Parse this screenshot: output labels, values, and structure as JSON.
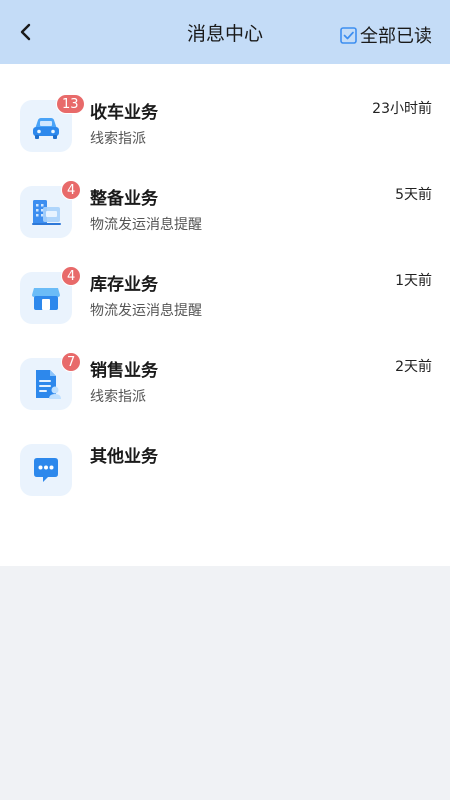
{
  "header": {
    "title": "消息中心",
    "mark_all_label": "全部已读",
    "icons": {
      "back": "chevron-left-icon",
      "mark_all": "checkbox-check-icon"
    }
  },
  "colors": {
    "header_bg": "#c4dcf7",
    "badge": "#e86a6a",
    "icon_bg": "#eaf3fd",
    "accent": "#3d8ef0"
  },
  "messages": [
    {
      "title": "收车业务",
      "subtitle": "线索指派",
      "time": "23小时前",
      "badge": "13",
      "icon": "car-icon"
    },
    {
      "title": "整备业务",
      "subtitle": "物流发运消息提醒",
      "time": "5天前",
      "badge": "4",
      "icon": "building-icon"
    },
    {
      "title": "库存业务",
      "subtitle": "物流发运消息提醒",
      "time": "1天前",
      "badge": "4",
      "icon": "store-icon"
    },
    {
      "title": "销售业务",
      "subtitle": "线索指派",
      "time": "2天前",
      "badge": "7",
      "icon": "document-person-icon"
    },
    {
      "title": "其他业务",
      "subtitle": "",
      "time": "",
      "badge": "",
      "icon": "chat-bubble-icon"
    }
  ]
}
